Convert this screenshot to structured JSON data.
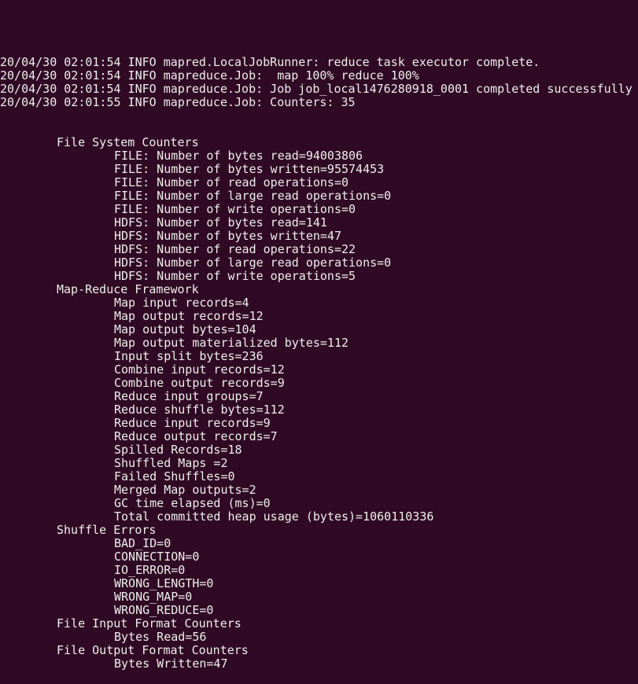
{
  "terminal": {
    "background": "#300a24",
    "foreground": "#eeeeec",
    "log_lines": [
      "20/04/30 02:01:54 INFO mapred.LocalJobRunner: reduce task executor complete.",
      "20/04/30 02:01:54 INFO mapreduce.Job:  map 100% reduce 100%",
      "20/04/30 02:01:54 INFO mapreduce.Job: Job job_local1476280918_0001 completed successfully",
      "20/04/30 02:01:55 INFO mapreduce.Job: Counters: 35"
    ],
    "counter_groups": [
      {
        "title": "File System Counters",
        "items": [
          "FILE: Number of bytes read=94003806",
          "FILE: Number of bytes written=95574453",
          "FILE: Number of read operations=0",
          "FILE: Number of large read operations=0",
          "FILE: Number of write operations=0",
          "HDFS: Number of bytes read=141",
          "HDFS: Number of bytes written=47",
          "HDFS: Number of read operations=22",
          "HDFS: Number of large read operations=0",
          "HDFS: Number of write operations=5"
        ]
      },
      {
        "title": "Map-Reduce Framework",
        "items": [
          "Map input records=4",
          "Map output records=12",
          "Map output bytes=104",
          "Map output materialized bytes=112",
          "Input split bytes=236",
          "Combine input records=12",
          "Combine output records=9",
          "Reduce input groups=7",
          "Reduce shuffle bytes=112",
          "Reduce input records=9",
          "Reduce output records=7",
          "Spilled Records=18",
          "Shuffled Maps =2",
          "Failed Shuffles=0",
          "Merged Map outputs=2",
          "GC time elapsed (ms)=0",
          "Total committed heap usage (bytes)=1060110336"
        ]
      },
      {
        "title": "Shuffle Errors",
        "items": [
          "BAD_ID=0",
          "CONNECTION=0",
          "IO_ERROR=0",
          "WRONG_LENGTH=0",
          "WRONG_MAP=0",
          "WRONG_REDUCE=0"
        ]
      },
      {
        "title": "File Input Format Counters",
        "items": [
          "Bytes Read=56"
        ]
      },
      {
        "title": "File Output Format Counters",
        "items": [
          "Bytes Written=47"
        ]
      }
    ]
  }
}
